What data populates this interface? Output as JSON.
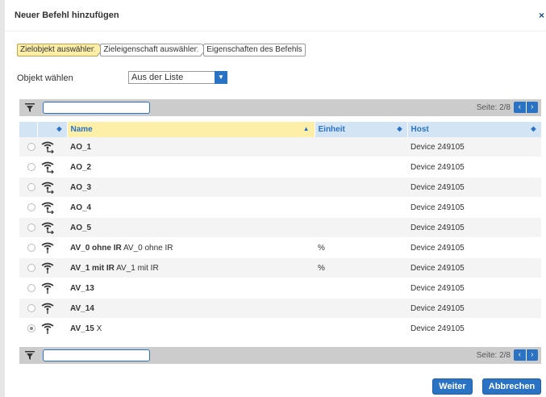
{
  "dialog": {
    "title": "Neuer Befehl hinzufügen",
    "close_label": "×"
  },
  "steps": [
    {
      "label": "Zielobjekt auswählen",
      "active": true
    },
    {
      "label": "Zieleigenschaft auswählen",
      "active": false
    },
    {
      "label": "Eigenschaften des Befehls",
      "active": false
    }
  ],
  "object_select": {
    "label": "Objekt wählen",
    "value": "Aus der Liste"
  },
  "toolbar_top": {
    "filter_value": "",
    "page_info": "Seite: 2/8",
    "prev_label": "‹",
    "next_label": "›"
  },
  "toolbar_bottom": {
    "filter_value": "",
    "page_info": "Seite: 2/8",
    "prev_label": "‹",
    "next_label": "›"
  },
  "table": {
    "columns": {
      "name": "Name",
      "unit": "Einheit",
      "host": "Host"
    },
    "rows": [
      {
        "name": "AO_1",
        "desc": "",
        "unit": "",
        "host": "Device 249105",
        "selected": false,
        "icon": "analog-output-icon"
      },
      {
        "name": "AO_2",
        "desc": "",
        "unit": "",
        "host": "Device 249105",
        "selected": false,
        "icon": "analog-output-icon"
      },
      {
        "name": "AO_3",
        "desc": "",
        "unit": "",
        "host": "Device 249105",
        "selected": false,
        "icon": "analog-output-icon"
      },
      {
        "name": "AO_4",
        "desc": "",
        "unit": "",
        "host": "Device 249105",
        "selected": false,
        "icon": "analog-output-icon"
      },
      {
        "name": "AO_5",
        "desc": "",
        "unit": "",
        "host": "Device 249105",
        "selected": false,
        "icon": "analog-output-icon"
      },
      {
        "name": "AV_0 ohne IR",
        "desc": "AV_0 ohne IR",
        "unit": "%",
        "host": "Device 249105",
        "selected": false,
        "icon": "analog-value-icon"
      },
      {
        "name": "AV_1 mit IR",
        "desc": "AV_1 mit IR",
        "unit": "%",
        "host": "Device 249105",
        "selected": false,
        "icon": "analog-value-icon"
      },
      {
        "name": "AV_13",
        "desc": "",
        "unit": "",
        "host": "Device 249105",
        "selected": false,
        "icon": "analog-value-icon"
      },
      {
        "name": "AV_14",
        "desc": "",
        "unit": "",
        "host": "Device 249105",
        "selected": false,
        "icon": "analog-value-icon"
      },
      {
        "name": "AV_15",
        "desc": "X",
        "unit": "",
        "host": "Device 249105",
        "selected": true,
        "icon": "analog-value-icon"
      }
    ]
  },
  "buttons": {
    "next": "Weiter",
    "cancel": "Abbrechen"
  },
  "colors": {
    "accent": "#2a72c4",
    "header_bg": "#d3e5f5",
    "active_step": "#fdeea8",
    "toolbar_bg": "#cccccc"
  }
}
